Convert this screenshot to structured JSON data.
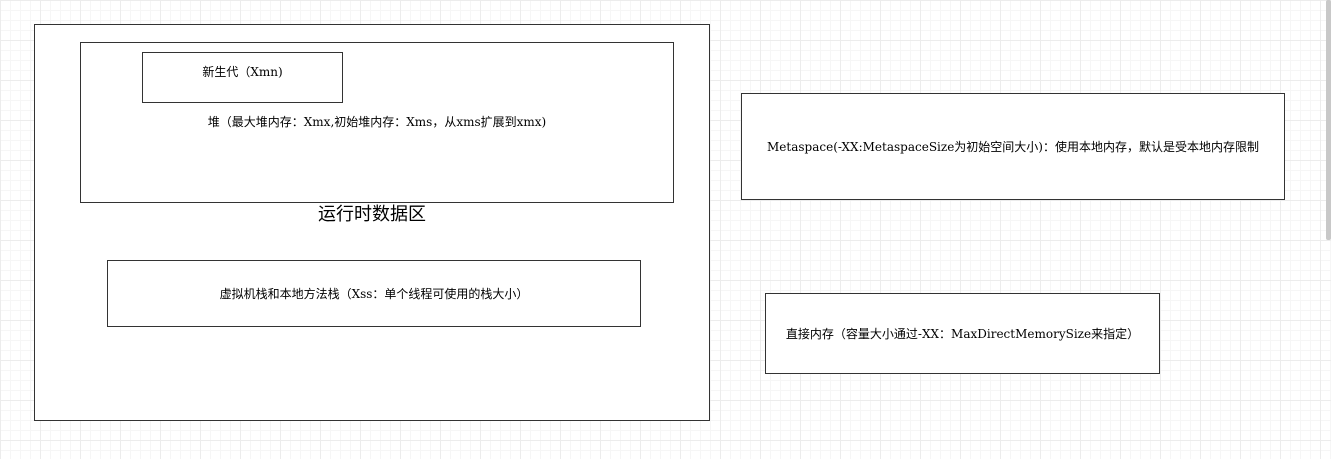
{
  "diagram": {
    "runtime_area": {
      "label": "运行时数据区"
    },
    "heap": {
      "label": "堆（最大堆内存：Xmx,初始堆内存：Xms，从xms扩展到xmx)"
    },
    "young_gen": {
      "label": "新生代（Xmn)"
    },
    "stack": {
      "label": "虚拟机栈和本地方法栈（Xss：单个线程可使用的栈大小）"
    },
    "metaspace": {
      "label": "Metaspace(-XX:MetaspaceSize为初始空间大小)：使用本地内存，默认是受本地内存限制"
    },
    "direct_memory": {
      "label": "直接内存（容量大小通过-XX：MaxDirectMemorySize来指定）"
    }
  },
  "colors": {
    "border": "#333333",
    "grid": "#ececec",
    "background": "#ffffff"
  }
}
